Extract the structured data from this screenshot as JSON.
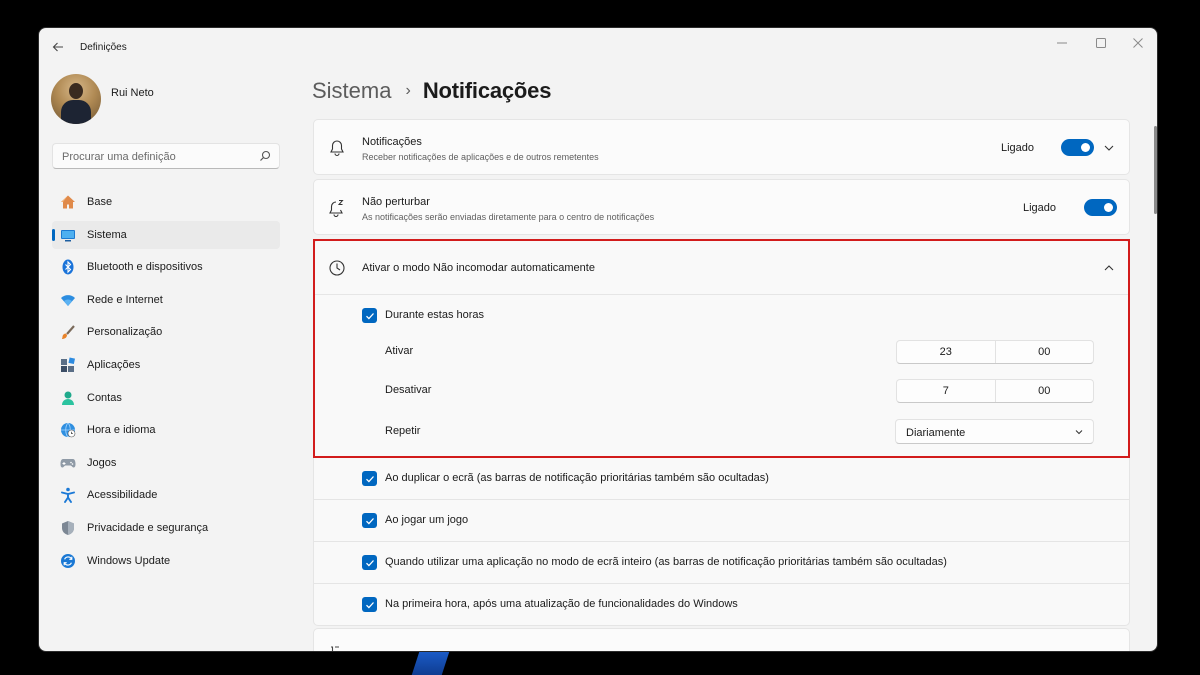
{
  "window": {
    "app_title": "Definições",
    "back_icon": "arrow-left-icon",
    "controls": [
      "minimize-icon",
      "maximize-icon",
      "close-icon"
    ]
  },
  "user": {
    "name": "Rui Neto"
  },
  "search": {
    "placeholder": "Procurar uma definição"
  },
  "sidebar": {
    "items": [
      {
        "label": "Base",
        "icon": "home-icon",
        "active": false
      },
      {
        "label": "Sistema",
        "icon": "system-icon",
        "active": true
      },
      {
        "label": "Bluetooth e dispositivos",
        "icon": "bluetooth-icon",
        "active": false
      },
      {
        "label": "Rede e Internet",
        "icon": "wifi-icon",
        "active": false
      },
      {
        "label": "Personalização",
        "icon": "brush-icon",
        "active": false
      },
      {
        "label": "Aplicações",
        "icon": "apps-icon",
        "active": false
      },
      {
        "label": "Contas",
        "icon": "account-icon",
        "active": false
      },
      {
        "label": "Hora e idioma",
        "icon": "globe-clock-icon",
        "active": false
      },
      {
        "label": "Jogos",
        "icon": "gamepad-icon",
        "active": false
      },
      {
        "label": "Acessibilidade",
        "icon": "accessibility-icon",
        "active": false
      },
      {
        "label": "Privacidade e segurança",
        "icon": "shield-icon",
        "active": false
      },
      {
        "label": "Windows Update",
        "icon": "update-icon",
        "active": false
      }
    ]
  },
  "breadcrumb": {
    "parent": "Sistema",
    "separator": "›",
    "current": "Notificações"
  },
  "notifications_card": {
    "title": "Notificações",
    "subtitle": "Receber notificações de aplicações e de outros remetentes",
    "state": "Ligado",
    "on": true
  },
  "dnd_card": {
    "title": "Não perturbar",
    "subtitle": "As notificações serão enviadas diretamente para o centro de notificações",
    "state": "Ligado",
    "on": true
  },
  "auto_dnd": {
    "title": "Ativar o modo Não incomodar automaticamente",
    "during_hours": {
      "label": "Durante estas horas",
      "checked": true
    },
    "start": {
      "label": "Ativar",
      "hour": "23",
      "minute": "00"
    },
    "end": {
      "label": "Desativar",
      "hour": "7",
      "minute": "00"
    },
    "repeat": {
      "label": "Repetir",
      "value": "Diariamente"
    }
  },
  "options": [
    {
      "label": "Ao duplicar o ecrã (as barras de notificação prioritárias também são ocultadas)",
      "checked": true
    },
    {
      "label": "Ao jogar um jogo",
      "checked": true
    },
    {
      "label": "Quando utilizar uma aplicação no modo de ecrã inteiro (as barras de notificação prioritárias também são ocultadas)",
      "checked": true
    },
    {
      "label": "Na primeira hora, após uma atualização de funcionalidades do Windows",
      "checked": true
    }
  ],
  "colors": {
    "accent": "#0067c0",
    "highlight": "#d21c1c",
    "window_bg": "#f3f3f3"
  }
}
